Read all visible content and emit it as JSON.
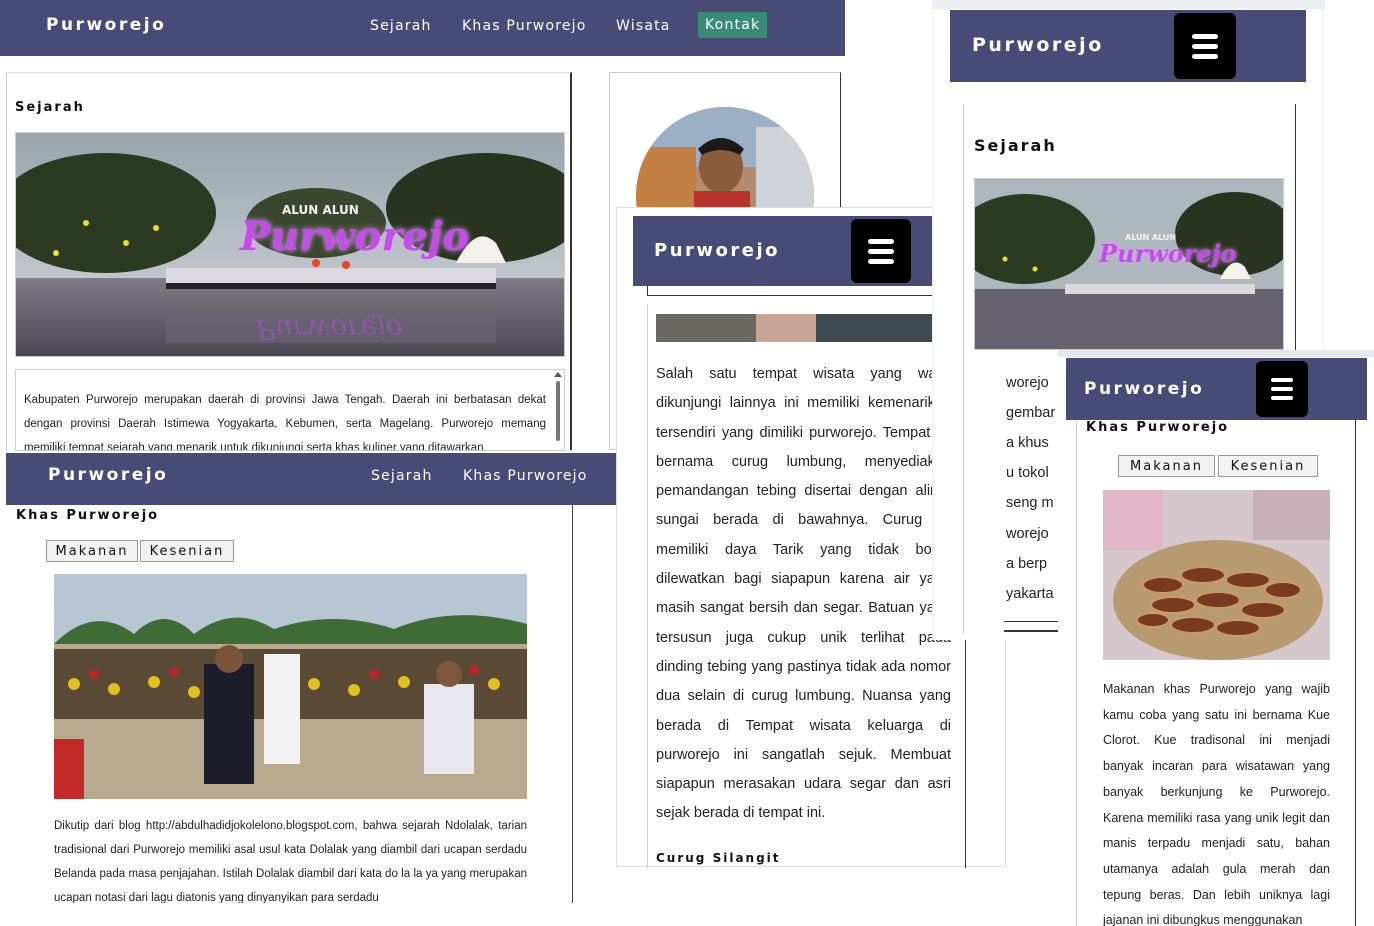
{
  "brand": "Purworejo",
  "nav": {
    "links": [
      "Sejarah",
      "Khas Purworejo",
      "Wisata",
      "Kontak"
    ]
  },
  "sections": {
    "sejarah": "Sejarah",
    "khas": "Khas Purworejo",
    "curug": "Curug Silangit"
  },
  "tabs": [
    "Makanan",
    "Kesenian"
  ],
  "images": {
    "alun_text_1": "ALUN ALUN",
    "alun_text_2": "Purworejo"
  },
  "texts": {
    "sejarah_para": "Kabupaten Purworejo merupakan daerah di provinsi Jawa Tengah. Daerah ini berbatasan dekat dengan provinsi Daerah Istimewa Yogyakarta, Kebumen, serta Magelang. Purworejo memang memiliki tempat sejarah yang menarik untuk dikunjungi serta khas kuliner yang ditawarkan.",
    "kesenian_para": "Dikutip dari blog http://abdulhadidjokolelono.blogspot.com, bahwa sejarah Ndolalak, tarian tradisional dari Purworejo memiliki asal usul kata Dolalak yang diambil dari ucapan serdadu Belanda pada masa penjajahan. Istilah Dolalak diambil dari kata do la la ya yang merupakan ucapan notasi dari lagu diatonis yang dinyanyikan para serdadu",
    "curug_para": "Salah satu tempat wisata yang wajib dikunjungi lainnya ini memiliki kemenarikan tersendiri yang dimiliki purworejo. Tempat ini bernama curug lumbung, menyediakan pemandangan tebing disertai dengan aliran sungai berada di bawahnya. Curug ini memiliki daya Tarik yang tidak boleh dilewatkan bagi siapapun karena air yang masih sangat bersih dan segar. Batuan yang tersusun juga cukup unik terlihat pada dinding tebing yang pastinya tidak ada nomor dua selain di curug lumbung. Nuansa yang berada di Tempat wisata keluarga di purworejo ini sangatlah sejuk. Membuat siapapun merasakan udara segar dan asri sejak berada di tempat ini.",
    "makanan_para": "Makanan khas Purworejo yang wajib kamu coba yang satu ini bernama Kue Clorot. Kue tradisonal ini menjadi banyak incaran para wisatawan yang banyak berkunjung ke Purworejo. Karena memiliki rasa yang unik legit dan manis terpadu menjadi satu, bahan utamanya adalah gula merah dan tepung beras. Dan lebih uniknya lagi jajanan ini dibungkus menggunakan",
    "partial_lines": [
      "worejo",
      "gembar",
      "a khus",
      "u tokol",
      "seng m",
      "worejo",
      "a berp",
      "yakarta"
    ]
  },
  "colors": {
    "nav_bg": "#474b76",
    "active_link_bg": "#3a8a78",
    "burger_bg": "#000000"
  }
}
